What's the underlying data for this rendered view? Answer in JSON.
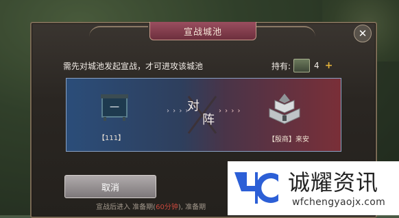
{
  "dialog": {
    "title": "宣战城池",
    "close_icon": "close-icon",
    "notice": "需先对城池发起宣战，才可进攻该城池",
    "hold_label": "持有:",
    "hold_count": "4",
    "plus_label": "+"
  },
  "versus": {
    "left_name": "【111】",
    "left_flag_text": "一",
    "arrows": "› › › ›",
    "vs_char_1": "对",
    "vs_char_2": "阵",
    "right_name": "【殷商】来安"
  },
  "actions": {
    "cancel_label": "取消"
  },
  "footer": {
    "text_a": "宣战后进入 准备期(",
    "highlight": "60分钟",
    "text_b": "), 准备期"
  },
  "watermark": {
    "name": "诚耀资讯",
    "url": "wfchengyaojx.com"
  },
  "colors": {
    "panel_blue": "#2b4d79",
    "panel_red": "#7a2f38",
    "title_bar": "#9a4e5f",
    "plus": "#e5b33b",
    "watermark_blue": "#2c5fd6"
  }
}
